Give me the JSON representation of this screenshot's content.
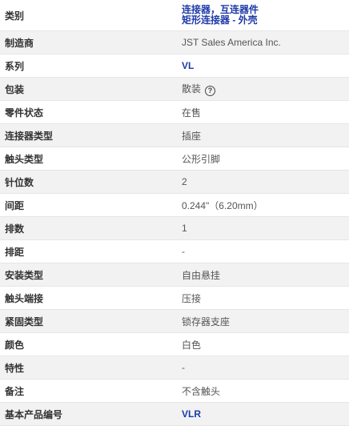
{
  "rows": [
    {
      "label": "类别",
      "links": [
        "连接器，互连器件",
        "矩形连接器 - 外壳"
      ]
    },
    {
      "label": "制造商",
      "value": "JST Sales America Inc."
    },
    {
      "label": "系列",
      "link": "VL"
    },
    {
      "label": "包装",
      "value": "散装",
      "help_icon": "question-circle-icon"
    },
    {
      "label": "零件状态",
      "value": "在售"
    },
    {
      "label": "连接器类型",
      "value": "插座"
    },
    {
      "label": "触头类型",
      "value": "公形引脚"
    },
    {
      "label": "针位数",
      "value": "2"
    },
    {
      "label": "间距",
      "value": "0.244\"（6.20mm）"
    },
    {
      "label": "排数",
      "value": "1"
    },
    {
      "label": "排距",
      "value": "-"
    },
    {
      "label": "安装类型",
      "value": "自由悬挂"
    },
    {
      "label": "触头端接",
      "value": "压接"
    },
    {
      "label": "紧固类型",
      "value": "锁存器支座"
    },
    {
      "label": "颜色",
      "value": "白色"
    },
    {
      "label": "特性",
      "value": "-"
    },
    {
      "label": "备注",
      "value": "不含触头"
    },
    {
      "label": "基本产品编号",
      "link": "VLR"
    }
  ],
  "colors": {
    "link": "#1f3aa8",
    "row_alt": "#f2f2f2",
    "border": "#e6e6e6"
  }
}
